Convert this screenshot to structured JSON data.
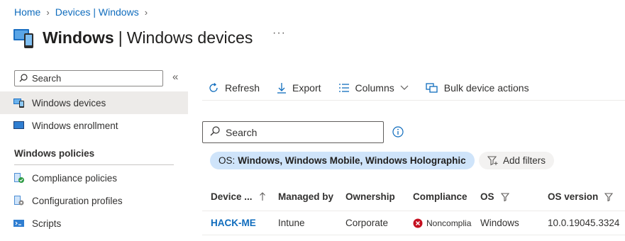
{
  "breadcrumb": [
    {
      "label": "Home"
    },
    {
      "label": "Devices | Windows"
    }
  ],
  "page": {
    "title_bold": "Windows",
    "title_sep": "|",
    "title_rest": "Windows devices",
    "more": "···"
  },
  "sidebar": {
    "search_placeholder": "Search",
    "collapse": "«",
    "items": [
      {
        "label": "Windows devices",
        "icon": "windows-devices-icon",
        "active": true
      },
      {
        "label": "Windows enrollment",
        "icon": "windows-enrollment-icon",
        "active": false
      }
    ],
    "section_title": "Windows policies",
    "policy_items": [
      {
        "label": "Compliance policies",
        "icon": "compliance-policies-icon"
      },
      {
        "label": "Configuration profiles",
        "icon": "configuration-profiles-icon"
      },
      {
        "label": "Scripts",
        "icon": "scripts-icon"
      }
    ]
  },
  "toolbar": {
    "refresh": "Refresh",
    "export": "Export",
    "columns": "Columns",
    "bulk": "Bulk device actions"
  },
  "main": {
    "search_placeholder": "Search",
    "filter_pill_key": "OS:",
    "filter_pill_value": "Windows, Windows Mobile, Windows Holographic",
    "add_filters": "Add filters"
  },
  "table": {
    "columns": [
      "Device ...",
      "Managed by",
      "Ownership",
      "Compliance",
      "OS",
      "OS version"
    ],
    "rows": [
      {
        "device": "HACK-ME",
        "managed_by": "Intune",
        "ownership": "Corporate",
        "compliance": "Noncomplia",
        "os": "Windows",
        "os_version": "10.0.19045.3324"
      }
    ]
  },
  "colors": {
    "accent": "#0f6cbd",
    "filter_pill": "#cfe4fa",
    "error": "#c50f1f"
  }
}
